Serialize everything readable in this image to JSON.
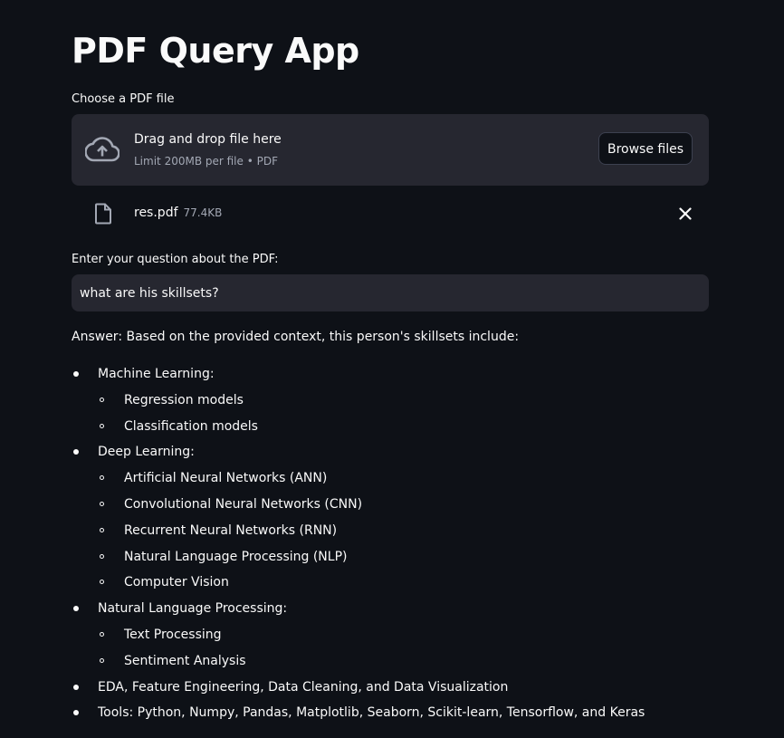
{
  "app": {
    "title": "PDF Query App"
  },
  "uploader": {
    "label": "Choose a PDF file",
    "drop_title": "Drag and drop file here",
    "limit_text": "Limit 200MB per file • PDF",
    "browse_label": "Browse files",
    "upload_icon": "cloud-upload-icon"
  },
  "uploaded_file": {
    "name": "res.pdf",
    "size": "77.4KB",
    "file_icon": "file-icon",
    "remove_icon": "close-icon"
  },
  "question": {
    "label": "Enter your question about the PDF:",
    "value": "what are his skillsets?"
  },
  "answer": {
    "intro": "Answer: Based on the provided context, this person's skillsets include:",
    "items": [
      {
        "text": "Machine Learning:",
        "level": 1
      },
      {
        "text": "Regression models",
        "level": 2
      },
      {
        "text": "Classification models",
        "level": 2
      },
      {
        "text": "Deep Learning:",
        "level": 1
      },
      {
        "text": "Artificial Neural Networks (ANN)",
        "level": 2
      },
      {
        "text": "Convolutional Neural Networks (CNN)",
        "level": 2
      },
      {
        "text": "Recurrent Neural Networks (RNN)",
        "level": 2
      },
      {
        "text": "Natural Language Processing (NLP)",
        "level": 2
      },
      {
        "text": "Computer Vision",
        "level": 2
      },
      {
        "text": "Natural Language Processing:",
        "level": 1
      },
      {
        "text": "Text Processing",
        "level": 2
      },
      {
        "text": "Sentiment Analysis",
        "level": 2
      },
      {
        "text": "EDA, Feature Engineering, Data Cleaning, and Data Visualization",
        "level": 1
      },
      {
        "text": "Tools: Python, Numpy, Pandas, Matplotlib, Seaborn, Scikit-learn, Tensorflow, and Keras",
        "level": 1
      }
    ]
  },
  "colors": {
    "background": "#0e1117",
    "panel": "#262730",
    "text": "#fafafa",
    "muted_text": "#a3a8b4"
  }
}
